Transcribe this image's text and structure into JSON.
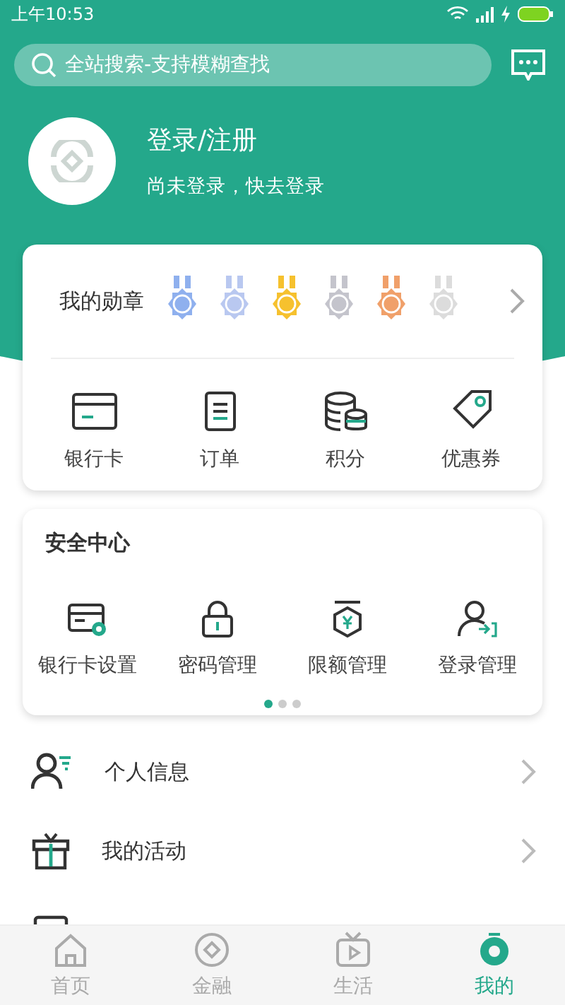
{
  "status_bar": {
    "time": "上午10:53"
  },
  "search": {
    "placeholder": "全站搜索-支持模糊查找"
  },
  "profile": {
    "title": "登录/注册",
    "subtitle": "尚未登录，快去登录"
  },
  "medals": {
    "label": "我的勋章",
    "items": [
      {
        "color": "#8fb0ee"
      },
      {
        "color": "#b9c8f0"
      },
      {
        "color": "#f6c12e"
      },
      {
        "color": "#c4c4cc"
      },
      {
        "color": "#f0a06a"
      },
      {
        "color": "#dcdcdc"
      }
    ]
  },
  "shortcuts": [
    {
      "label": "银行卡"
    },
    {
      "label": "订单"
    },
    {
      "label": "积分"
    },
    {
      "label": "优惠券"
    }
  ],
  "security": {
    "title": "安全中心",
    "items": [
      {
        "label": "银行卡设置"
      },
      {
        "label": "密码管理"
      },
      {
        "label": "限额管理"
      },
      {
        "label": "登录管理"
      }
    ],
    "pages": [
      {
        "selected": true
      },
      {
        "selected": false
      },
      {
        "selected": false
      }
    ]
  },
  "menu": [
    {
      "label": "个人信息"
    },
    {
      "label": "我的活动"
    }
  ],
  "tabs": [
    {
      "label": "首页",
      "selected": false
    },
    {
      "label": "金融",
      "selected": false
    },
    {
      "label": "生活",
      "selected": false
    },
    {
      "label": "我的",
      "selected": true
    }
  ]
}
